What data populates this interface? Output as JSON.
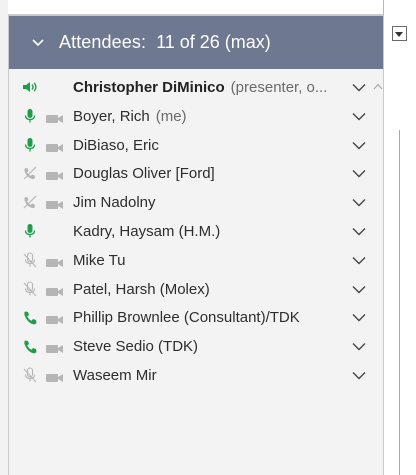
{
  "panel": {
    "title": "Attendees:",
    "count": "11 of 26 (max)"
  },
  "attendees": [
    {
      "name": "Christopher DiMinico",
      "suffix": "(presenter, o...",
      "bold": true,
      "status": "speaker",
      "camera": false
    },
    {
      "name": "Boyer, Rich",
      "suffix": "(me)",
      "bold": false,
      "status": "mic-on",
      "camera": true
    },
    {
      "name": "DiBiaso, Eric",
      "suffix": "",
      "bold": false,
      "status": "mic-on",
      "camera": true
    },
    {
      "name": "Douglas Oliver [Ford]",
      "suffix": "",
      "bold": false,
      "status": "phone-off",
      "camera": true
    },
    {
      "name": "Jim Nadolny",
      "suffix": "",
      "bold": false,
      "status": "phone-off",
      "camera": true
    },
    {
      "name": "Kadry, Haysam (H.M.)",
      "suffix": "",
      "bold": false,
      "status": "mic-on",
      "camera": false
    },
    {
      "name": "Mike Tu",
      "suffix": "",
      "bold": false,
      "status": "mic-off",
      "camera": true
    },
    {
      "name": "Patel, Harsh (Molex)",
      "suffix": "",
      "bold": false,
      "status": "mic-off",
      "camera": true
    },
    {
      "name": "Phillip Brownlee (Consultant)/TDK",
      "suffix": "",
      "bold": false,
      "status": "phone-on",
      "camera": true
    },
    {
      "name": "Steve Sedio (TDK)",
      "suffix": "",
      "bold": false,
      "status": "phone-on",
      "camera": true
    },
    {
      "name": "Waseem Mir",
      "suffix": "",
      "bold": false,
      "status": "mic-off",
      "camera": true
    }
  ],
  "colors": {
    "header_bg": "#6f7891",
    "active_green": "#1f9d4a",
    "inactive_gray": "#b5b5b5"
  }
}
